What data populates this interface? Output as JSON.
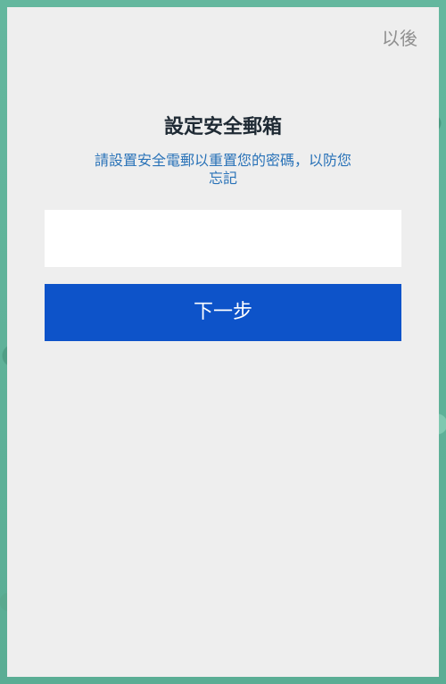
{
  "header": {
    "skip_label": "以後"
  },
  "content": {
    "title": "設定安全郵箱",
    "description": "請設置安全電郵以重置您的密碼，以防您忘記"
  },
  "form": {
    "email_value": "",
    "email_placeholder": ""
  },
  "actions": {
    "next_label": "下一步"
  }
}
